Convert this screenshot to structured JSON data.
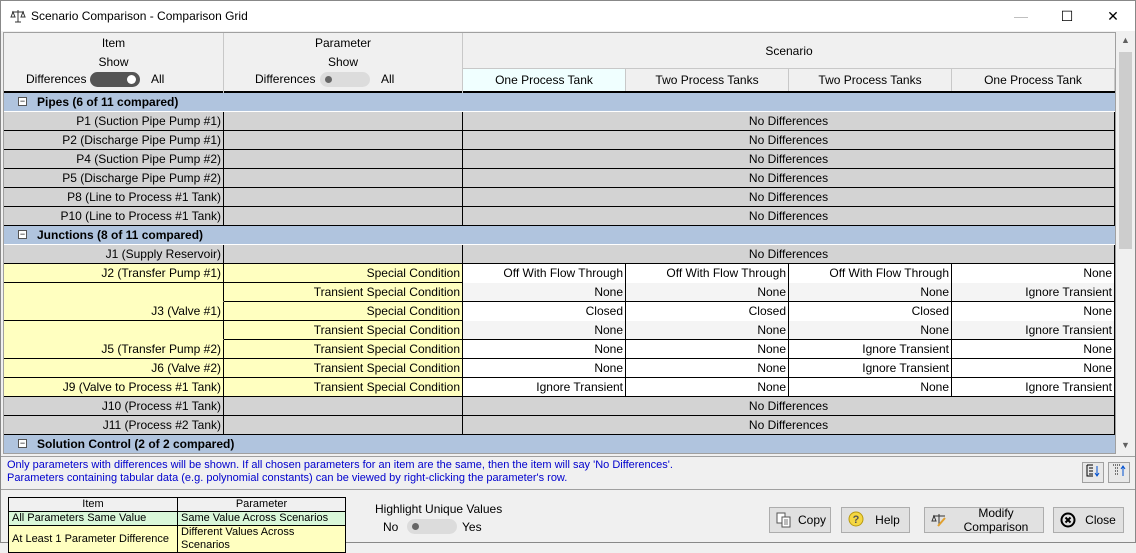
{
  "window": {
    "title": "Scenario Comparison - Comparison Grid",
    "icon": "scale-icon",
    "controls": {
      "minimize": "—",
      "maximize": "☐",
      "close": "✕"
    }
  },
  "header": {
    "item": {
      "title": "Item",
      "show_label": "Show",
      "left_label": "Differences",
      "right_label": "All",
      "toggle_state": "All"
    },
    "parameter": {
      "title": "Parameter",
      "show_label": "Show",
      "left_label": "Differences",
      "right_label": "All",
      "toggle_state": "Differences"
    },
    "scenario": {
      "title": "Scenario",
      "columns": [
        "One Process Tank",
        "Two Process Tanks",
        "Two Process Tanks",
        "One Process Tank"
      ],
      "selected_column": 0
    }
  },
  "groups": [
    {
      "label": "Pipes (6 of 11 compared)",
      "expand_glyph": "−",
      "rows": [
        {
          "item": "P1 (Suction Pipe Pump #1)",
          "param": "",
          "status": "No Differences"
        },
        {
          "item": "P2 (Discharge Pipe Pump #1)",
          "param": "",
          "status": "No Differences"
        },
        {
          "item": "P4 (Suction Pipe Pump #2)",
          "param": "",
          "status": "No Differences"
        },
        {
          "item": "P5 (Discharge Pipe Pump #2)",
          "param": "",
          "status": "No Differences"
        },
        {
          "item": "P8 (Line to Process #1 Tank)",
          "param": "",
          "status": "No Differences"
        },
        {
          "item": "P10 (Line to Process #1 Tank)",
          "param": "",
          "status": "No Differences"
        }
      ]
    },
    {
      "label": "Junctions (8 of 11 compared)",
      "expand_glyph": "−",
      "rows": [
        {
          "item": "J1 (Supply Reservoir)",
          "param": "",
          "status": "No Differences"
        },
        {
          "item": "J2 (Transfer Pump #1)",
          "param": "Special Condition",
          "values": [
            "Off With Flow Through",
            "Off With Flow Through",
            "Off With Flow Through",
            "None"
          ]
        },
        {
          "item": "",
          "param": "Transient Special Condition",
          "values": [
            "None",
            "None",
            "None",
            "Ignore Transient"
          ]
        },
        {
          "item": "J3 (Valve #1)",
          "param": "Special Condition",
          "values": [
            "Closed",
            "Closed",
            "Closed",
            "None"
          ]
        },
        {
          "item": "",
          "param": "Transient Special Condition",
          "values": [
            "None",
            "None",
            "None",
            "Ignore Transient"
          ]
        },
        {
          "item": "J5 (Transfer Pump #2)",
          "param": "Transient Special Condition",
          "values": [
            "None",
            "None",
            "Ignore Transient",
            "None"
          ]
        },
        {
          "item": "J6 (Valve #2)",
          "param": "Transient Special Condition",
          "values": [
            "None",
            "None",
            "Ignore Transient",
            "None"
          ]
        },
        {
          "item": "J9 (Valve to Process #1 Tank)",
          "param": "Transient Special Condition",
          "values": [
            "Ignore Transient",
            "None",
            "None",
            "Ignore Transient"
          ]
        },
        {
          "item": "J10 (Process #1 Tank)",
          "param": "",
          "status": "No Differences"
        },
        {
          "item": "J11 (Process #2 Tank)",
          "param": "",
          "status": "No Differences"
        }
      ]
    },
    {
      "label": "Solution Control (2 of 2 compared)",
      "expand_glyph": "−",
      "rows": []
    }
  ],
  "info": {
    "line1": "Only parameters with differences will be shown. If all chosen parameters for an item are the same, then the item will say 'No Differences'.",
    "line2": "Parameters containing tabular data (e.g. polynomial constants) can be viewed by right-clicking the parameter's row."
  },
  "legend": {
    "header_item": "Item",
    "header_param": "Parameter",
    "same_item": "All Parameters Same Value",
    "same_param": "Same Value Across Scenarios",
    "diff_item": "At Least 1 Parameter Difference",
    "diff_param": "Different Values Across Scenarios",
    "colors": {
      "same": "#d9f7d9",
      "diff": "#ffffc0"
    }
  },
  "highlight": {
    "title": "Highlight Unique Values",
    "no_label": "No",
    "yes_label": "Yes",
    "state": "No"
  },
  "buttons": {
    "copy": "Copy",
    "help": "Help",
    "modify": "Modify Comparison",
    "close": "Close"
  },
  "colors": {
    "group_bg": "#b0c4de",
    "item_same_bg": "#d3d3d3",
    "item_diff_bg": "#ffffc0",
    "info_text": "#0000cd"
  }
}
